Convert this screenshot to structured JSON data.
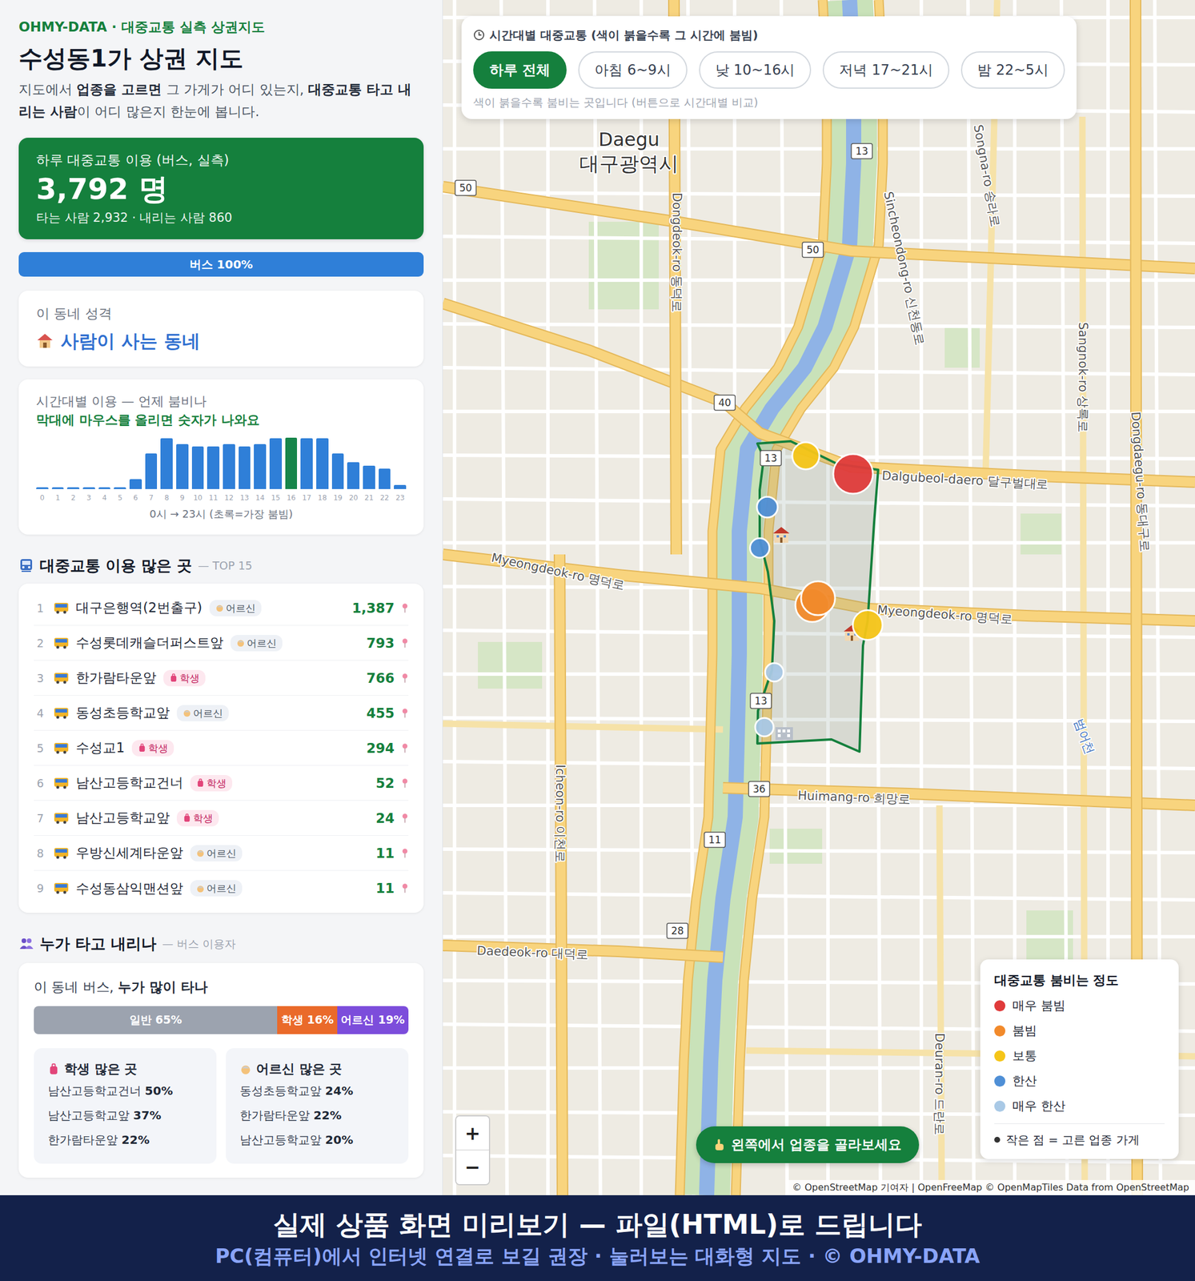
{
  "brand": "OHMY-DATA · 대중교통 실측 상권지도",
  "title": "수성동1가 상권 지도",
  "description": [
    {
      "text": "지도에서 ",
      "bold": false
    },
    {
      "text": "업종을 고르면",
      "bold": true
    },
    {
      "text": " 그 가게가 어디 있는지, ",
      "bold": false
    },
    {
      "text": "대중교통 타고 내리는 사람",
      "bold": true
    },
    {
      "text": "이 어디 많은지 한눈에 봅니다.",
      "bold": false
    }
  ],
  "summary": {
    "label": "하루 대중교통 이용 (버스, 실측)",
    "total": "3,792 명",
    "detail": "타는 사람 2,932 · 내리는 사람 860"
  },
  "mode_bar": [
    {
      "label": "버스 100%",
      "level": 1,
      "color": "#2f7fd8"
    }
  ],
  "character": {
    "label": "이 동네 성격",
    "value": "사람이 사는 동네"
  },
  "hourly": {
    "title": "시간대별 이용 — 언제 붐비나",
    "hint": "막대에 마우스를 올리면 숫자가 나와요",
    "hours": [
      "0",
      "1",
      "2",
      "3",
      "4",
      "5",
      "6",
      "7",
      "8",
      "9",
      "10",
      "11",
      "12",
      "13",
      "14",
      "15",
      "16",
      "17",
      "18",
      "19",
      "20",
      "21",
      "22",
      "23"
    ],
    "values": [
      9,
      9,
      9,
      9,
      9,
      9,
      55,
      196,
      283,
      251,
      237,
      237,
      251,
      237,
      251,
      283,
      285,
      283,
      283,
      196,
      150,
      128,
      114,
      23
    ],
    "peak_index": 16,
    "caption": "0시 → 23시 (초록=가장 붐빔)"
  },
  "top_stops": {
    "title": "대중교통 이용 많은 곳",
    "suffix": "— TOP 15",
    "rows": [
      {
        "rank": "1",
        "name": "대구은행역(2번출구)",
        "group": "어르신",
        "kind": "senior",
        "count": "1,387",
        "color": "#e03b3b"
      },
      {
        "rank": "2",
        "name": "수성롯데캐슬더퍼스트앞",
        "group": "어르신",
        "kind": "senior",
        "count": "793",
        "color": "#f28a2b"
      },
      {
        "rank": "3",
        "name": "한가람타운앞",
        "group": "학생",
        "kind": "student",
        "count": "766",
        "color": "#f28a2b"
      },
      {
        "rank": "4",
        "name": "동성초등학교앞",
        "group": "어르신",
        "kind": "senior",
        "count": "455",
        "color": "#f5c518"
      },
      {
        "rank": "5",
        "name": "수성교1",
        "group": "학생",
        "kind": "student",
        "count": "294",
        "color": "#f5c518"
      },
      {
        "rank": "6",
        "name": "남산고등학교건너",
        "group": "학생",
        "kind": "student",
        "count": "52",
        "color": "#4f8fd6"
      },
      {
        "rank": "7",
        "name": "남산고등학교앞",
        "group": "학생",
        "kind": "student",
        "count": "24",
        "color": "#4f8fd6"
      },
      {
        "rank": "8",
        "name": "우방신세계타운앞",
        "group": "어르신",
        "kind": "senior",
        "count": "11",
        "color": "#a9c9e6"
      },
      {
        "rank": "9",
        "name": "수성동삼익맨션앞",
        "group": "어르신",
        "kind": "senior",
        "count": "11",
        "color": "#a9c9e6"
      }
    ]
  },
  "riders": {
    "title": "누가 타고 내리나",
    "suffix": "— 버스 이용자",
    "heading": [
      {
        "text": "이 동네 버스, ",
        "bold": false
      },
      {
        "text": "누가 많이 타나",
        "bold": true
      }
    ],
    "segments": [
      {
        "label": "일반 65%",
        "level": 0.65,
        "color": "#9ca3af"
      },
      {
        "label": "학생 16%",
        "level": 0.16,
        "color": "#ea6a2a"
      },
      {
        "label": "어르신 19%",
        "level": 0.19,
        "color": "#7c4ddb"
      }
    ],
    "groups": [
      {
        "title": "학생 많은 곳",
        "kind": "student",
        "items": [
          {
            "name": "남산고등학교건너",
            "share": "50%"
          },
          {
            "name": "남산고등학교앞",
            "share": "37%"
          },
          {
            "name": "한가람타운앞",
            "share": "22%"
          }
        ]
      },
      {
        "title": "어르신 많은 곳",
        "kind": "senior",
        "items": [
          {
            "name": "동성초등학교앞",
            "share": "24%"
          },
          {
            "name": "한가람타운앞",
            "share": "22%"
          },
          {
            "name": "남산고등학교앞",
            "share": "20%"
          }
        ]
      }
    ]
  },
  "map": {
    "filter": {
      "title": "시간대별 대중교통 (색이 붉을수록 그 시간에 붐빔)",
      "options": [
        {
          "label": "하루 전체",
          "selected": true
        },
        {
          "label": "아침 6~9시",
          "selected": false
        },
        {
          "label": "낮 10~16시",
          "selected": false
        },
        {
          "label": "저녁 17~21시",
          "selected": false
        },
        {
          "label": "밤 22~5시",
          "selected": false
        }
      ],
      "note": "색이 붉을수록 붐비는 곳입니다 (버튼으로 시간대별 비교)"
    },
    "labels": [
      "Daegu",
      "대구광역시",
      "Dalgubeol-daero 달구벌대로",
      "Myeongdeok-ro 명덕로",
      "Myeongdeok-ro 명덕로",
      "Huimang-ro 희망로",
      "Daedeok-ro 대덕로",
      "Sincheondong-ro 신천동로",
      "Dongdeok-ro 동덕로",
      "Icheon-ro 이천로",
      "Sangnok-ro 상록로",
      "Dongdaegu-ro 동대구로",
      "Songna-ro 송라로",
      "Deuran-ro 드란로",
      "범어천"
    ],
    "shields": [
      "13",
      "50",
      "50",
      "40",
      "13",
      "13",
      "36",
      "11",
      "28"
    ],
    "legend": {
      "title": "대중교통 붐비는 정도",
      "items": [
        {
          "label": "매우 붐빔",
          "color": "#e03b3b"
        },
        {
          "label": "붐빔",
          "color": "#f28a2b"
        },
        {
          "label": "보통",
          "color": "#f5c518"
        },
        {
          "label": "한산",
          "color": "#4f8fd6"
        },
        {
          "label": "매우 한산",
          "color": "#a9c9e6"
        }
      ],
      "footer": "작은 점 = 고른 업종 가게"
    },
    "zoom": [
      "+",
      "−"
    ],
    "cta": "왼쪽에서 업종을 골라보세요",
    "attribution": "© OpenStreetMap 기여자 | OpenFreeMap © OpenMapTiles Data from OpenStreetMap"
  },
  "banner": {
    "title": "실제 상품 화면 미리보기 — 파일(HTML)로 드립니다",
    "subtitle": "PC(컴퓨터)에서 인터넷 연결로 보길 권장 · 눌러보는 대화형 지도 · © OHMY-DATA"
  }
}
